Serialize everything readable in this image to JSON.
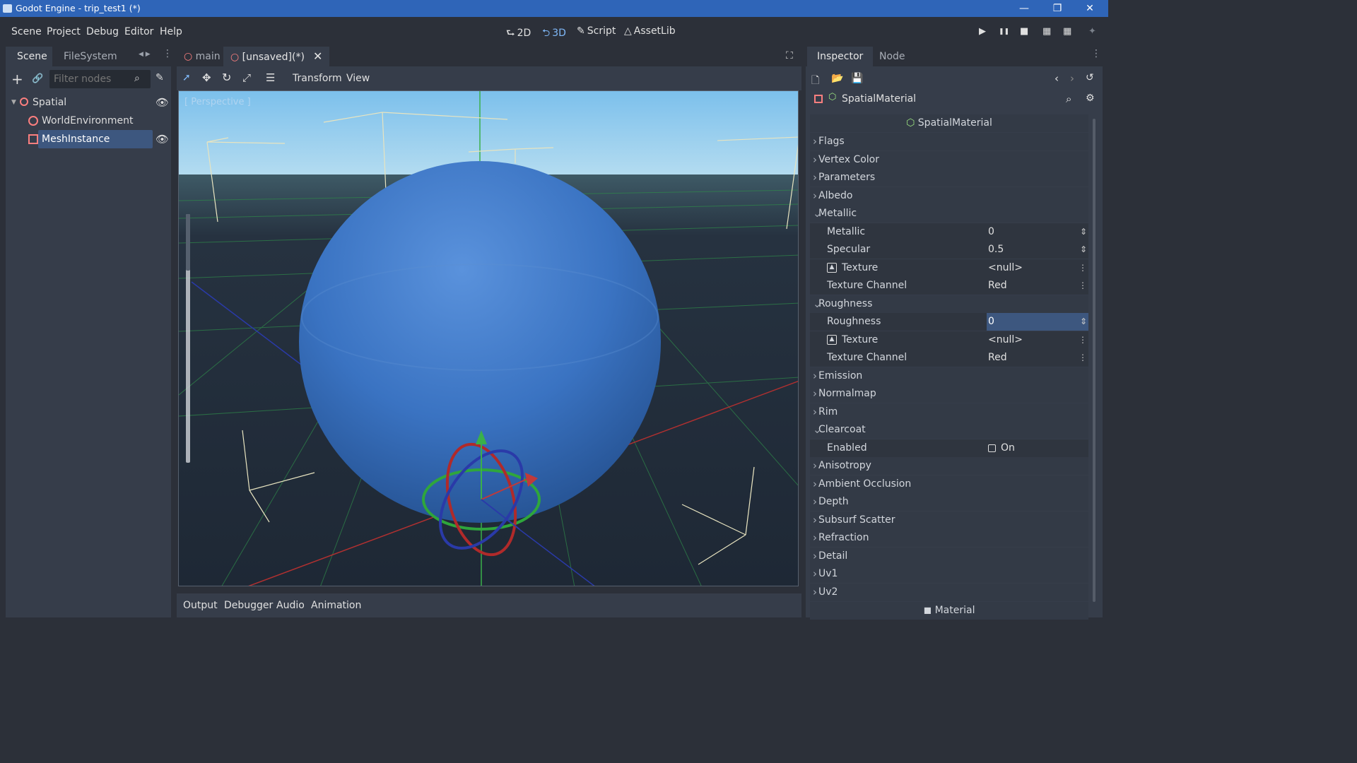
{
  "window": {
    "title": "Godot Engine - trip_test1 (*)",
    "controls": [
      "—",
      "❐",
      "✕"
    ]
  },
  "menu": [
    "Scene",
    "Project",
    "Debug",
    "Editor",
    "Help"
  ],
  "workspaces": [
    {
      "icon": "⮑",
      "label": "2D"
    },
    {
      "icon": "⮌",
      "label": "3D"
    },
    {
      "icon": "✎",
      "label": "Script"
    },
    {
      "icon": "△",
      "label": "AssetLib"
    }
  ],
  "playback": [
    "▶",
    "❚❚",
    "■",
    "▦",
    "▦",
    "✦"
  ],
  "left_dock": {
    "tabs": [
      "Scene",
      "FileSystem"
    ],
    "filter_placeholder": "Filter nodes",
    "tree": [
      {
        "label": "Spatial"
      },
      {
        "label": "WorldEnvironment"
      },
      {
        "label": "MeshInstance"
      }
    ]
  },
  "scene_tabs": [
    {
      "label": "main"
    },
    {
      "label": "[unsaved](*)"
    }
  ],
  "viewport_toolbar": {
    "transform": "Transform",
    "view": "View"
  },
  "viewport": {
    "label": "[ Perspective ]",
    "sky_top": "#7cc0ec",
    "sky_bottom": "#b4dcf0",
    "floor": "#263240",
    "sphere": "#3a73c2"
  },
  "bottom_tabs": [
    "Output",
    "Debugger",
    "Audio",
    "Animation"
  ],
  "inspector": {
    "tabs": [
      "Inspector",
      "Node"
    ],
    "resource": "SpatialMaterial",
    "header": "SpatialMaterial",
    "footer": "Material",
    "rows": [
      {
        "type": "sec",
        "label": "Flags",
        "open": false
      },
      {
        "type": "sec",
        "label": "Vertex Color",
        "open": false
      },
      {
        "type": "sec",
        "label": "Parameters",
        "open": false
      },
      {
        "type": "sec",
        "label": "Albedo",
        "open": false
      },
      {
        "type": "sec",
        "label": "Metallic",
        "open": true
      },
      {
        "type": "prop",
        "label": "Metallic",
        "value": "0",
        "widget": "spin"
      },
      {
        "type": "prop",
        "label": "Specular",
        "value": "0.5",
        "widget": "spin"
      },
      {
        "type": "prop",
        "label": "Texture",
        "value": "<null>",
        "widget": "menu",
        "icon": true
      },
      {
        "type": "prop",
        "label": "Texture Channel",
        "value": "Red",
        "widget": "menu"
      },
      {
        "type": "sec",
        "label": "Roughness",
        "open": true
      },
      {
        "type": "prop",
        "label": "Roughness",
        "value": "0",
        "widget": "spin",
        "editing": true
      },
      {
        "type": "prop",
        "label": "Texture",
        "value": "<null>",
        "widget": "menu",
        "icon": true
      },
      {
        "type": "prop",
        "label": "Texture Channel",
        "value": "Red",
        "widget": "menu"
      },
      {
        "type": "sec",
        "label": "Emission",
        "open": false
      },
      {
        "type": "sec",
        "label": "Normalmap",
        "open": false
      },
      {
        "type": "sec",
        "label": "Rim",
        "open": false
      },
      {
        "type": "sec",
        "label": "Clearcoat",
        "open": true
      },
      {
        "type": "prop",
        "label": "Enabled",
        "value": "On",
        "widget": "check"
      },
      {
        "type": "sec",
        "label": "Anisotropy",
        "open": false
      },
      {
        "type": "sec",
        "label": "Ambient Occlusion",
        "open": false
      },
      {
        "type": "sec",
        "label": "Depth",
        "open": false
      },
      {
        "type": "sec",
        "label": "Subsurf Scatter",
        "open": false
      },
      {
        "type": "sec",
        "label": "Refraction",
        "open": false
      },
      {
        "type": "sec",
        "label": "Detail",
        "open": false
      },
      {
        "type": "sec",
        "label": "Uv1",
        "open": false
      },
      {
        "type": "sec",
        "label": "Uv2",
        "open": false
      }
    ]
  }
}
